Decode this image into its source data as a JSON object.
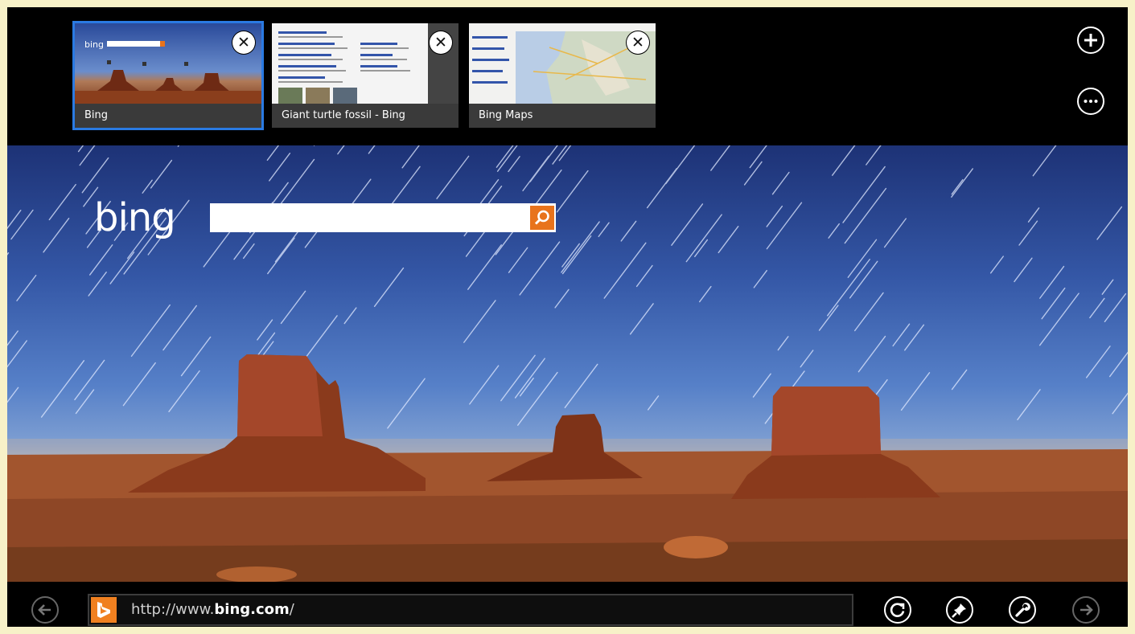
{
  "tabs": [
    {
      "title": "Bing",
      "active": true
    },
    {
      "title": "Giant turtle fossil - Bing",
      "active": false
    },
    {
      "title": "Bing Maps",
      "active": false
    }
  ],
  "tab_close_symbol": "✕",
  "toolbar_top": {
    "new_tab_icon": "plus-icon",
    "more_icon": "ellipsis-icon"
  },
  "page": {
    "logo_text": "bing",
    "search_value": "",
    "search_icon": "magnifier-icon"
  },
  "address_bar": {
    "url_prefix": "http://www.",
    "url_domain": "bing.com",
    "url_suffix": "/",
    "favicon": "bing-favicon"
  },
  "appbar_icons": [
    "back-icon",
    "refresh-icon",
    "pin-icon",
    "tools-icon",
    "forward-icon"
  ],
  "colors": {
    "accent": "#2a7ae2",
    "bing_orange": "#e8731c",
    "chrome": "#000000"
  }
}
